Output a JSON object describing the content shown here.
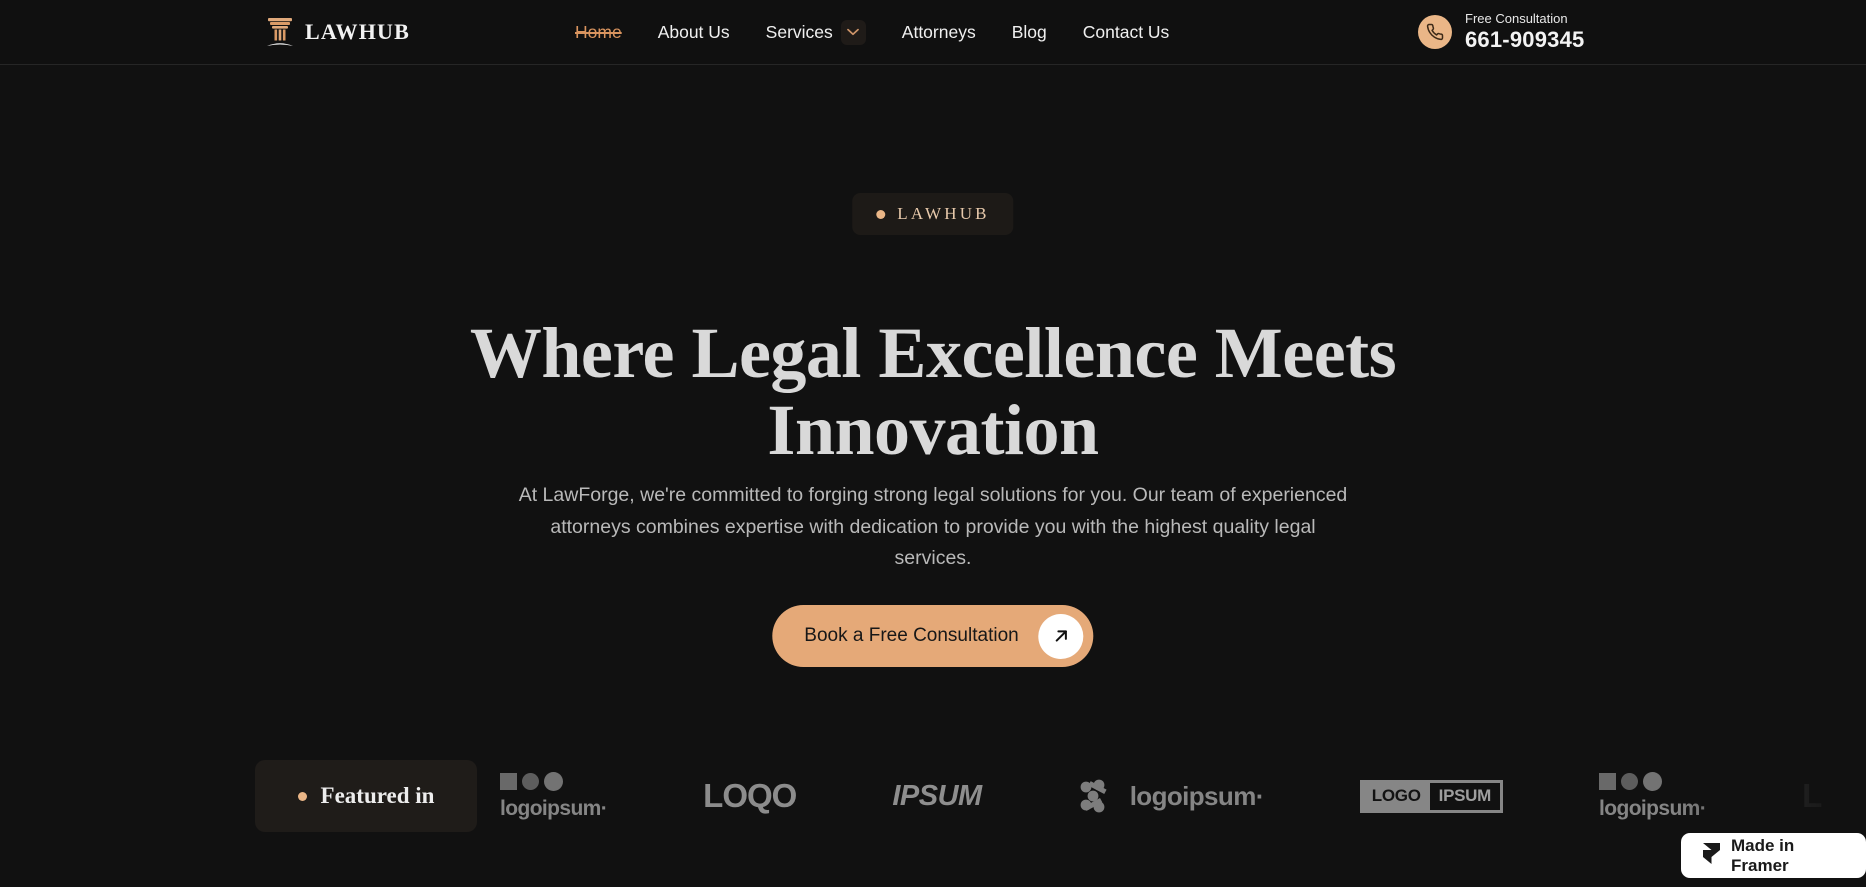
{
  "header": {
    "brand": {
      "icon": "pillar-icon",
      "name": "LAWHUB"
    },
    "nav": [
      {
        "label": "Home",
        "active": true
      },
      {
        "label": "About Us",
        "active": false
      },
      {
        "label": "Services",
        "active": false,
        "chevron": "chevron-down-icon"
      },
      {
        "label": "Attorneys",
        "active": false
      },
      {
        "label": "Blog",
        "active": false
      },
      {
        "label": "Contact Us",
        "active": false
      }
    ],
    "phone": {
      "icon": "phone-icon",
      "label": "Free Consultation",
      "number": "661-909345"
    }
  },
  "hero": {
    "badge": {
      "dot": "bullet-dot-icon",
      "text": "LAWHUB"
    },
    "headline": "Where Legal Excellence Meets Innovation",
    "subtext": "At LawForge, we're committed to forging strong legal solutions for you. Our team of experienced attorneys combines expertise with dedication to provide you with the highest quality legal services.",
    "cta": {
      "label": "Book a Free Consultation",
      "icon": "arrow-up-right-icon"
    }
  },
  "featured": {
    "dot": "bullet-dot-icon",
    "label": "Featured in",
    "logos": [
      {
        "name": "logoipsum-shapes",
        "text": "logoipsum"
      },
      {
        "name": "loqo-wordmark",
        "text": "LOQO"
      },
      {
        "name": "ipsum-wordmark",
        "text": "IPSUM"
      },
      {
        "name": "logoipsum-nodes",
        "text": "logoipsum"
      },
      {
        "name": "logo-ipsum-boxed",
        "text_a": "LOGO",
        "text_b": "IPSUM"
      },
      {
        "name": "logoipsum-shapes-2",
        "text": "logoipsum"
      }
    ]
  },
  "framer_badge": {
    "icon": "framer-icon",
    "label": "Made in Framer"
  },
  "colors": {
    "page_background": "#0e0e0e",
    "hero_background": "#111111",
    "header_background": "#101010",
    "accent": "#e5a978",
    "accent_badge": "#eab687",
    "heading": "#d9d9d9",
    "body_text": "#b9b9b9",
    "nav_active": "#d9945f"
  }
}
